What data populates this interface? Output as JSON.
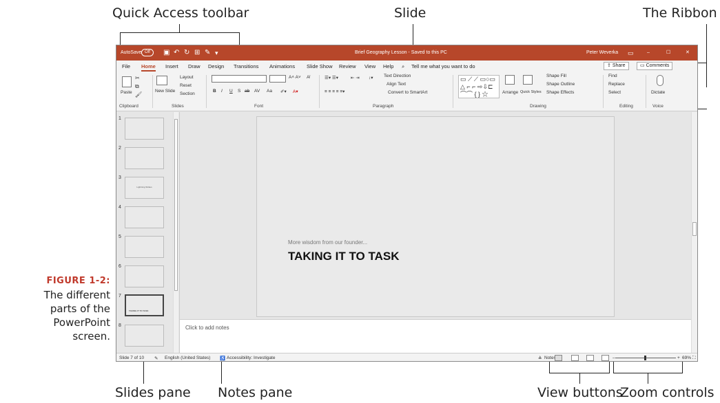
{
  "callouts": {
    "quick_access": "Quick Access toolbar",
    "slide": "Slide",
    "ribbon": "The Ribbon",
    "slides_pane": "Slides pane",
    "notes_pane": "Notes pane",
    "view_buttons": "View buttons",
    "zoom_controls": "Zoom controls"
  },
  "figure": {
    "number": "FIGURE 1-2:",
    "caption_lines": [
      "The different",
      "parts of the",
      "PowerPoint",
      "screen."
    ]
  },
  "titlebar": {
    "autosave": "AutoSave",
    "autosave_state": "Off",
    "doc_title": "Brief Geography Lesson - Saved to this PC",
    "user": "Peter Weverka",
    "minimize": "–",
    "maximize": "☐",
    "close": "✕"
  },
  "tabs": [
    "File",
    "Home",
    "Insert",
    "Draw",
    "Design",
    "Transitions",
    "Animations",
    "Slide Show",
    "Review",
    "View",
    "Help"
  ],
  "tell_me": "Tell me what you want to do",
  "share": "Share",
  "comments": "Comments",
  "ribbon": {
    "clipboard": {
      "paste": "Paste",
      "label": "Clipboard"
    },
    "slides": {
      "new_slide": "New Slide",
      "layout": "Layout",
      "reset": "Reset",
      "section": "Section",
      "label": "Slides"
    },
    "font": {
      "label": "Font",
      "styles": [
        "B",
        "I",
        "U",
        "S",
        "ab",
        "AV",
        "Aa"
      ]
    },
    "paragraph": {
      "label": "Paragraph",
      "text_direction": "Text Direction",
      "align_text": "Align Text",
      "convert": "Convert to SmartArt"
    },
    "drawing": {
      "label": "Drawing",
      "arrange": "Arrange",
      "quick_styles": "Quick Styles",
      "shape_fill": "Shape Fill",
      "shape_outline": "Shape Outline",
      "shape_effects": "Shape Effects"
    },
    "editing": {
      "label": "Editing",
      "find": "Find",
      "replace": "Replace",
      "select": "Select"
    },
    "voice": {
      "label": "Voice",
      "dictate": "Dictate"
    }
  },
  "thumbnails": [
    {
      "num": "1",
      "title": ""
    },
    {
      "num": "2",
      "title": ""
    },
    {
      "num": "3",
      "title": "Lightning Strikes"
    },
    {
      "num": "4",
      "title": ""
    },
    {
      "num": "5",
      "title": ""
    },
    {
      "num": "6",
      "title": ""
    },
    {
      "num": "7",
      "title": "TAKING IT TO TASK"
    },
    {
      "num": "8",
      "title": ""
    }
  ],
  "slide": {
    "kicker": "More wisdom from our founder...",
    "headline": "TAKING IT TO TASK"
  },
  "notes_placeholder": "Click to add notes",
  "status": {
    "slide_count": "Slide 7 of 10",
    "language": "English (United States)",
    "accessibility": "Accessibility: Investigate",
    "notes": "Notes",
    "zoom": "69%"
  }
}
